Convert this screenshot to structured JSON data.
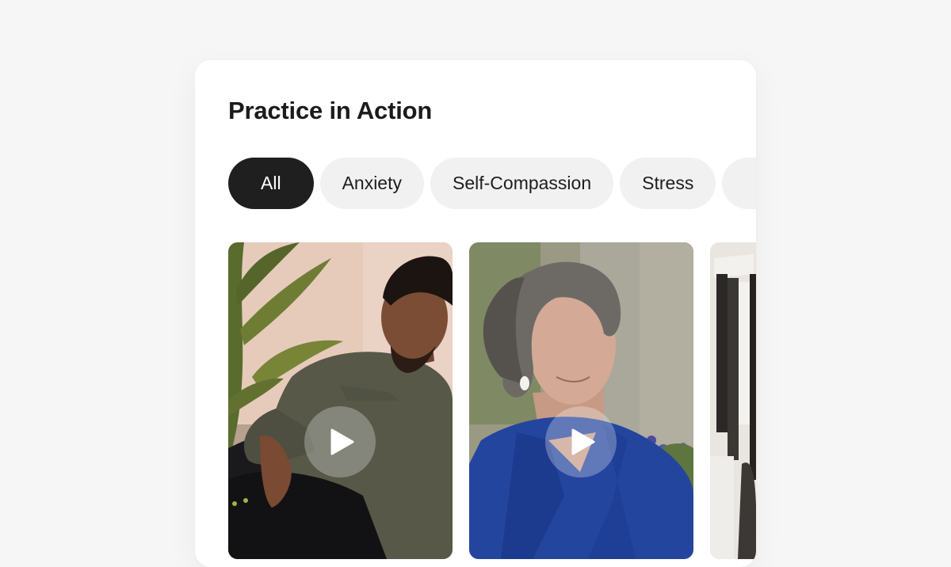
{
  "section": {
    "title": "Practice in Action"
  },
  "filters": [
    {
      "label": "All",
      "active": true
    },
    {
      "label": "Anxiety",
      "active": false
    },
    {
      "label": "Self-Compassion",
      "active": false
    },
    {
      "label": "Stress",
      "active": false
    },
    {
      "label": "",
      "active": false
    }
  ],
  "videos": [
    {
      "icon": "play-icon",
      "scene": "man-with-plant-and-cat"
    },
    {
      "icon": "play-icon",
      "scene": "woman-looking-up-outdoors"
    },
    {
      "icon": "play-icon",
      "scene": "closet-clothes-rack"
    }
  ],
  "colors": {
    "background": "#f6f6f6",
    "card": "#ffffff",
    "chip_active": "#1f1f1f",
    "chip_inactive": "#f1f1f1",
    "text": "#1b1b1b"
  }
}
